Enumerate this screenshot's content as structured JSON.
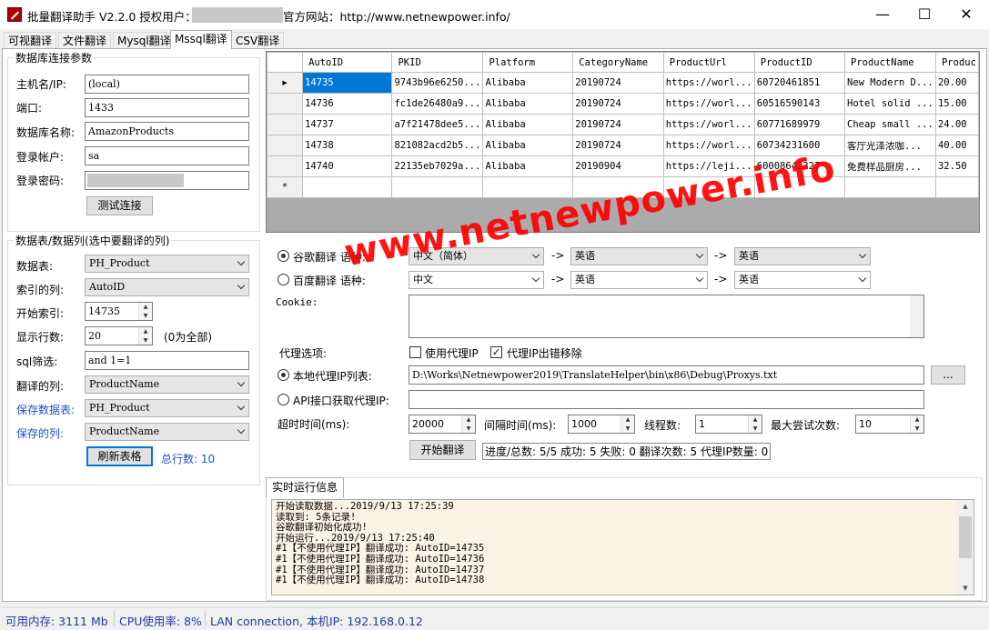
{
  "window": {
    "title": "批量翻译助手 V2.2.0 授权用户：s",
    "site": "官方网站：http://www.netnewpower.info/",
    "min": "—",
    "max": "☐",
    "close": "✕"
  },
  "tabs": [
    {
      "label": "可视翻译"
    },
    {
      "label": "文件翻译"
    },
    {
      "label": "Mysql翻译"
    },
    {
      "label": "Mssql翻译"
    },
    {
      "label": "CSV翻译"
    }
  ],
  "db": {
    "legend": "数据库连接参数",
    "host_label": "主机名/IP:",
    "host": "(local)",
    "port_label": "端口:",
    "port": "1433",
    "dbname_label": "数据库名称:",
    "dbname": "AmazonProducts",
    "user_label": "登录帐户:",
    "user": "sa",
    "pwd_label": "登录密码:",
    "test_button": "测试连接"
  },
  "table": {
    "legend": "数据表/数据列(选中要翻译的列)",
    "table_label": "数据表:",
    "table_value": "PH_Product",
    "index_label": "索引的列:",
    "index_value": "AutoID",
    "start_label": "开始索引:",
    "start_value": "14735",
    "rows_label": "显示行数:",
    "rows_value": "20",
    "rows_hint": "(0为全部)",
    "sql_label": "sql筛选:",
    "sql_value": "and 1=1",
    "trans_label": "翻译的列:",
    "trans_value": "ProductName",
    "save_table_label": "保存数据表:",
    "save_table_value": "PH_Product",
    "save_col_label": "保存的列:",
    "save_col_value": "ProductName",
    "refresh_button": "刷新表格",
    "total": "总行数: 10"
  },
  "grid": {
    "columns": [
      "AutoID",
      "PKID",
      "Platform",
      "CategoryName",
      "ProductUrl",
      "ProductID",
      "ProductName",
      "Produc"
    ],
    "rows": [
      [
        "14735",
        "9743b96e6250...",
        "Alibaba",
        "20190724",
        "https://worl...",
        "60720461851",
        "New Modern D...",
        "20.00"
      ],
      [
        "14736",
        "fc1de26480a9...",
        "Alibaba",
        "20190724",
        "https://worl...",
        "60516590143",
        "Hotel solid ...",
        "15.00"
      ],
      [
        "14737",
        "a7f21478dee5...",
        "Alibaba",
        "20190724",
        "https://worl...",
        "60771689979",
        "Cheap small ...",
        "24.00"
      ],
      [
        "14738",
        "821082acd2b5...",
        "Alibaba",
        "20190724",
        "https://worl...",
        "60734231600",
        "客厅光泽浓咖...",
        "40.00"
      ],
      [
        "14740",
        "22135eb7029a...",
        "Alibaba",
        "20190904",
        "https://leji...",
        "60008642327",
        "免费样品厨房...",
        "32.50"
      ]
    ],
    "current_marker": "▸",
    "new_marker": "*"
  },
  "translate": {
    "google_label": "谷歌翻译 语种:",
    "google_from": "中文（简体）",
    "arrow": "->",
    "google_mid": "英语",
    "google_to": "英语",
    "baidu_label": "百度翻译 语种:",
    "baidu_from": "中文",
    "baidu_mid": "英语",
    "baidu_to": "英语",
    "cookie_label": "Cookie:",
    "proxy_label": "代理选项:",
    "use_proxy": "使用代理IP",
    "proxy_remove": "代理IP出错移除",
    "local_proxy_label": "本地代理IP列表:",
    "local_proxy_path": "D:\\Works\\Netnewpower2019\\TranslateHelper\\bin\\x86\\Debug\\Proxys.txt",
    "browse": "...",
    "api_proxy_label": "API接口获取代理IP:",
    "timeout_label": "超时时间(ms):",
    "timeout": "20000",
    "interval_label": "间隔时间(ms):",
    "interval": "1000",
    "threads_label": "线程数:",
    "threads": "1",
    "retries_label": "最大尝试次数:",
    "retries": "10",
    "start_button": "开始翻译",
    "progress": "进度/总数: 5/5 成功: 5 失败: 0 翻译次数: 5 代理IP数量: 0"
  },
  "log": {
    "tab": "实时运行信息",
    "lines": "开始读取数据...2019/9/13 17:25:39\n读取到: 5条记录!\n谷歌翻译初始化成功!\n开始运行...2019/9/13 17:25:40\n#1【不使用代理IP】翻译成功: AutoID=14735\n#1【不使用代理IP】翻译成功: AutoID=14736\n#1【不使用代理IP】翻译成功: AutoID=14737\n#1【不使用代理IP】翻译成功: AutoID=14738"
  },
  "status": {
    "memory": "可用内存: 3111 Mb",
    "cpu": "CPU使用率: 8%",
    "net": "LAN connection, 本机IP: 192.168.0.12"
  },
  "watermark": "www.netnewpower.info",
  "colors": {
    "accent": "#0078d7",
    "link_label": "#1e50c8",
    "watermark": "#ff0000",
    "log_bg": "#fbf3e4"
  }
}
